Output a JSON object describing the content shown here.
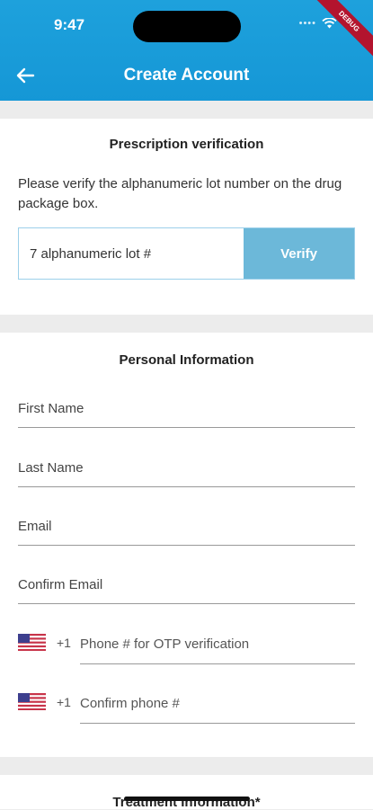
{
  "status_bar": {
    "time": "9:47",
    "debug_label": "DEBUG"
  },
  "header": {
    "title": "Create Account",
    "back_icon": "arrow-left-icon"
  },
  "prescription": {
    "title": "Prescription verification",
    "description": "Please verify the alphanumeric lot number on the drug package box.",
    "lot_placeholder": "7 alphanumeric lot #",
    "verify_label": "Verify"
  },
  "personal": {
    "title": "Personal Information",
    "first_name_placeholder": "First Name",
    "last_name_placeholder": "Last Name",
    "email_placeholder": "Email",
    "confirm_email_placeholder": "Confirm Email",
    "phone": {
      "country_code": "+1",
      "flag_icon": "us-flag-icon",
      "placeholder": "Phone # for OTP verification"
    },
    "confirm_phone": {
      "country_code": "+1",
      "flag_icon": "us-flag-icon",
      "placeholder": "Confirm phone #"
    }
  },
  "treatment": {
    "title": "Treatment Information*"
  },
  "colors": {
    "header": "#1597d6",
    "verify_button": "#6cb8d9",
    "debug_ribbon": "#b3142e"
  }
}
